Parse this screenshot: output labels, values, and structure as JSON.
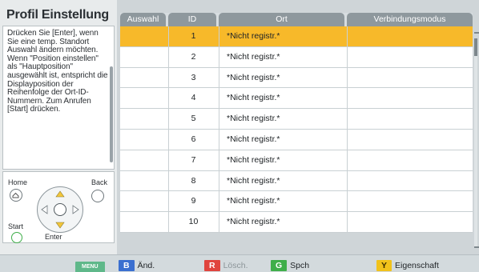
{
  "panel": {
    "title": "Profil Einstellung",
    "help_text": "Drücken Sie [Enter], wenn Sie eine temp. Standort Auswahl ändern möchten. Wenn \"Position einstellen\" als \"Hauptposition\" ausgewählt ist, entspricht die Displayposition der Reihenfolge der Ort-ID-Nummern. Zum Anrufen [Start] drücken."
  },
  "remote": {
    "home_label": "Home",
    "back_label": "Back",
    "start_label": "Start",
    "enter_label": "Enter"
  },
  "table": {
    "headers": [
      "Auswahl",
      "ID",
      "Ort",
      "Verbindungsmodus"
    ],
    "rows": [
      {
        "id": "1",
        "ort": "*Nicht registr.*",
        "selected": true
      },
      {
        "id": "2",
        "ort": "*Nicht registr.*"
      },
      {
        "id": "3",
        "ort": "*Nicht registr.*"
      },
      {
        "id": "4",
        "ort": "*Nicht registr.*"
      },
      {
        "id": "5",
        "ort": "*Nicht registr.*"
      },
      {
        "id": "6",
        "ort": "*Nicht registr.*"
      },
      {
        "id": "7",
        "ort": "*Nicht registr.*"
      },
      {
        "id": "8",
        "ort": "*Nicht registr.*"
      },
      {
        "id": "9",
        "ort": "*Nicht registr.*"
      },
      {
        "id": "10",
        "ort": "*Nicht registr.*"
      }
    ]
  },
  "bottom": {
    "menu_badge": "MENU",
    "b_badge": "B",
    "b_label": "Änd.",
    "r_badge": "R",
    "r_label": "Lösch.",
    "g_badge": "G",
    "g_label": "Spch",
    "y_badge": "Y",
    "y_label": "Eigenschaft"
  },
  "colors": {
    "selection": "#f7b92a",
    "header": "#8e989d",
    "blue": "#3a6fd0",
    "red": "#e0443d",
    "green": "#3fae4a",
    "yellow": "#f1c21b",
    "menu": "#5fb88a"
  }
}
